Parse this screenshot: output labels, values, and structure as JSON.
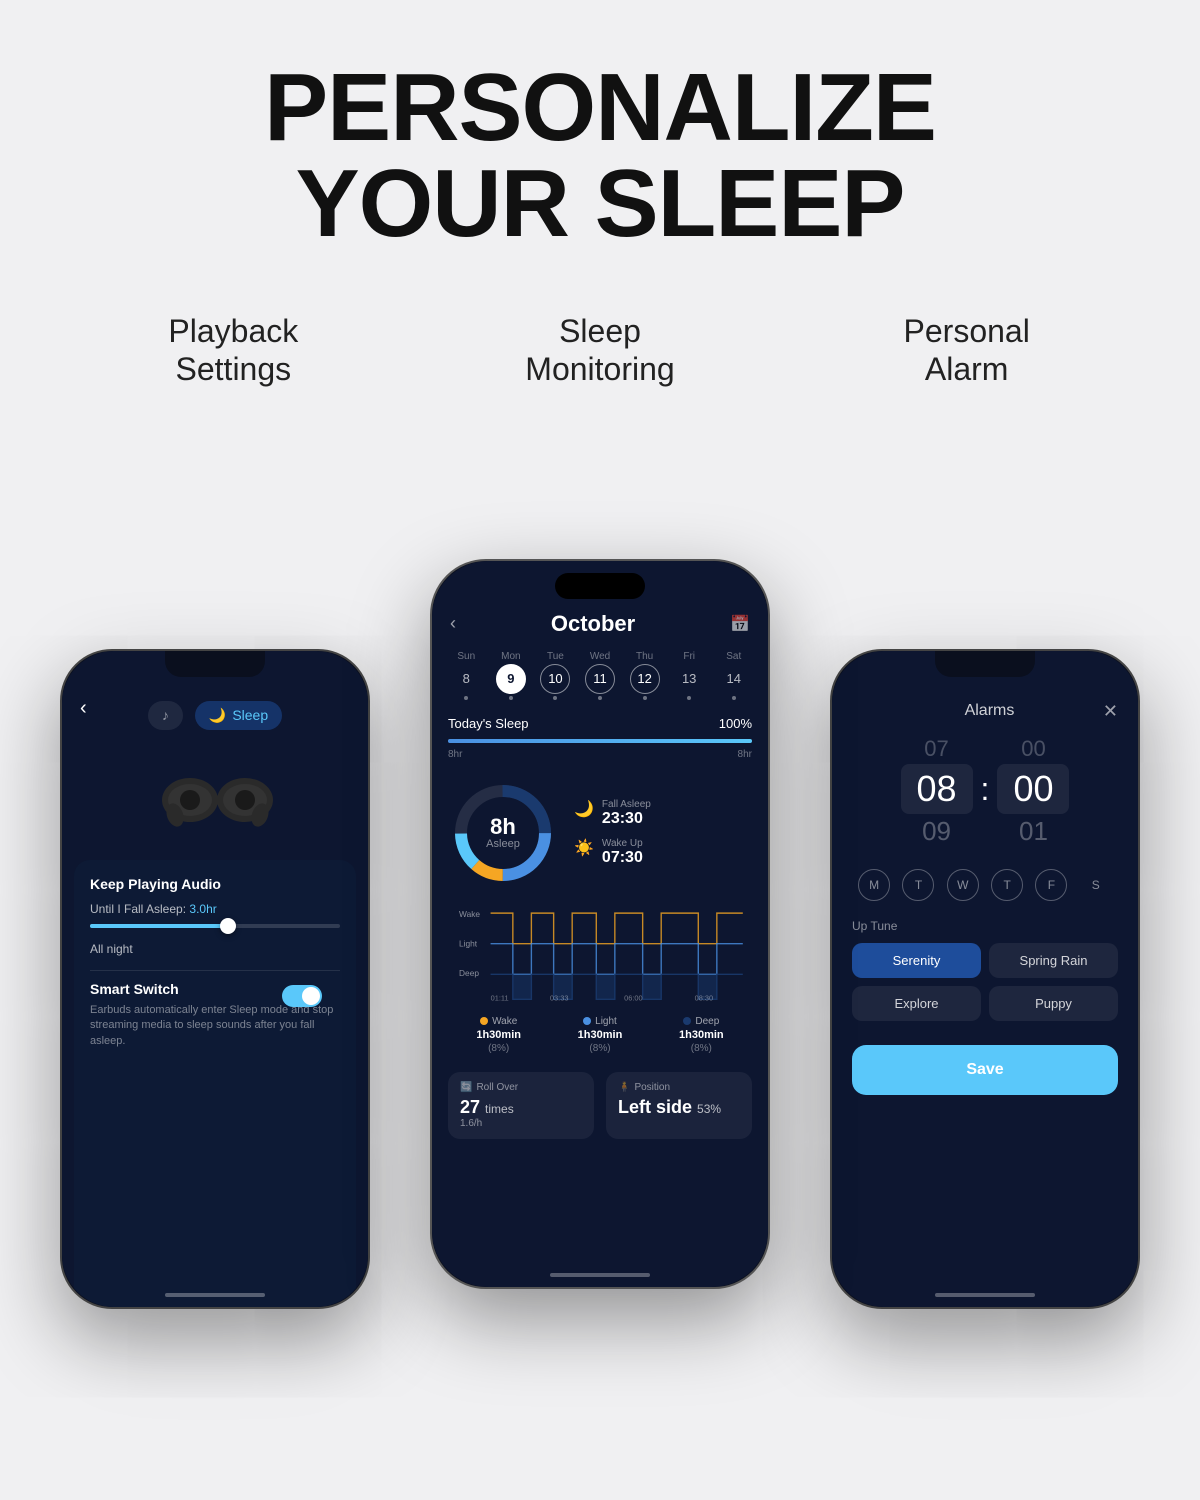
{
  "page": {
    "bg_color": "#f0f0f2",
    "main_title_line1": "PERSONALIZE",
    "main_title_line2": "YOUR SLEEP"
  },
  "section_labels": {
    "left": "Playback\nSettings",
    "center": "Sleep\nMonitoring",
    "right": "Personal\nAlarm"
  },
  "left_phone": {
    "back_arrow": "‹",
    "tab_music": "♪",
    "tab_sleep": "Sleep",
    "tab_music_label": "Music",
    "earbud_alt": "earbuds",
    "panel_title": "Keep Playing Audio",
    "fall_asleep_label": "Until I Fall Asleep:",
    "fall_asleep_value": "3.0hr",
    "all_night": "All night",
    "smart_switch_title": "Smart Switch",
    "smart_switch_desc": "Earbuds automatically enter Sleep mode and stop streaming media to sleep sounds after you fall asleep."
  },
  "center_phone": {
    "month": "October",
    "days": [
      {
        "label": "Sun",
        "num": "8",
        "state": "normal"
      },
      {
        "label": "Mon",
        "num": "9",
        "state": "active"
      },
      {
        "label": "Tue",
        "num": "10",
        "state": "selected"
      },
      {
        "label": "Wed",
        "num": "11",
        "state": "selected"
      },
      {
        "label": "Thu",
        "num": "12",
        "state": "selected"
      },
      {
        "label": "Fri",
        "num": "13",
        "state": "normal"
      },
      {
        "label": "Sat",
        "num": "14",
        "state": "normal"
      }
    ],
    "today_sleep_label": "Today's Sleep",
    "today_sleep_pct": "100%",
    "sleep_start_label": "8hr",
    "sleep_end_label": "8hr",
    "donut_center_value": "8h",
    "donut_center_label": "Asleep",
    "fall_asleep_label": "Fall Asleep",
    "fall_asleep_time": "23:30",
    "wake_up_label": "Wake Up",
    "wake_up_time": "07:30",
    "graph_labels": [
      "Wake",
      "Light",
      "Deep"
    ],
    "graph_times": [
      "01:11",
      "03:33",
      "06:00",
      "08:30"
    ],
    "legend": [
      {
        "name": "Wake",
        "time": "1h30min",
        "pct": "(8%)",
        "color": "#f5a623"
      },
      {
        "name": "Light",
        "time": "1h30min",
        "pct": "(8%)",
        "color": "#4a90e2"
      },
      {
        "name": "Deep",
        "time": "1h30min",
        "pct": "(8%)",
        "color": "#1a3a6e"
      }
    ],
    "roll_over_label": "Roll Over",
    "roll_over_value": "27 times",
    "roll_over_rate": "1.6/h",
    "position_label": "Position",
    "position_value": "Left side",
    "position_pct": "53%"
  },
  "right_phone": {
    "header_title": "Alarms",
    "close_btn": "✕",
    "time_above": "07",
    "time_selected_h": "08",
    "time_below": "09",
    "time_above_m": "00",
    "time_selected_m": "00",
    "time_below_m": "01",
    "days": [
      "M",
      "T",
      "W",
      "T",
      "F",
      "S"
    ],
    "wake_up_tune_label": "Up Tune",
    "tunes": [
      {
        "label": "Serenity",
        "selected": true
      },
      {
        "label": "Spring Rain",
        "selected": false
      },
      {
        "label": "Explore",
        "selected": false
      },
      {
        "label": "Puppy",
        "selected": false
      }
    ],
    "save_label": "Save"
  }
}
